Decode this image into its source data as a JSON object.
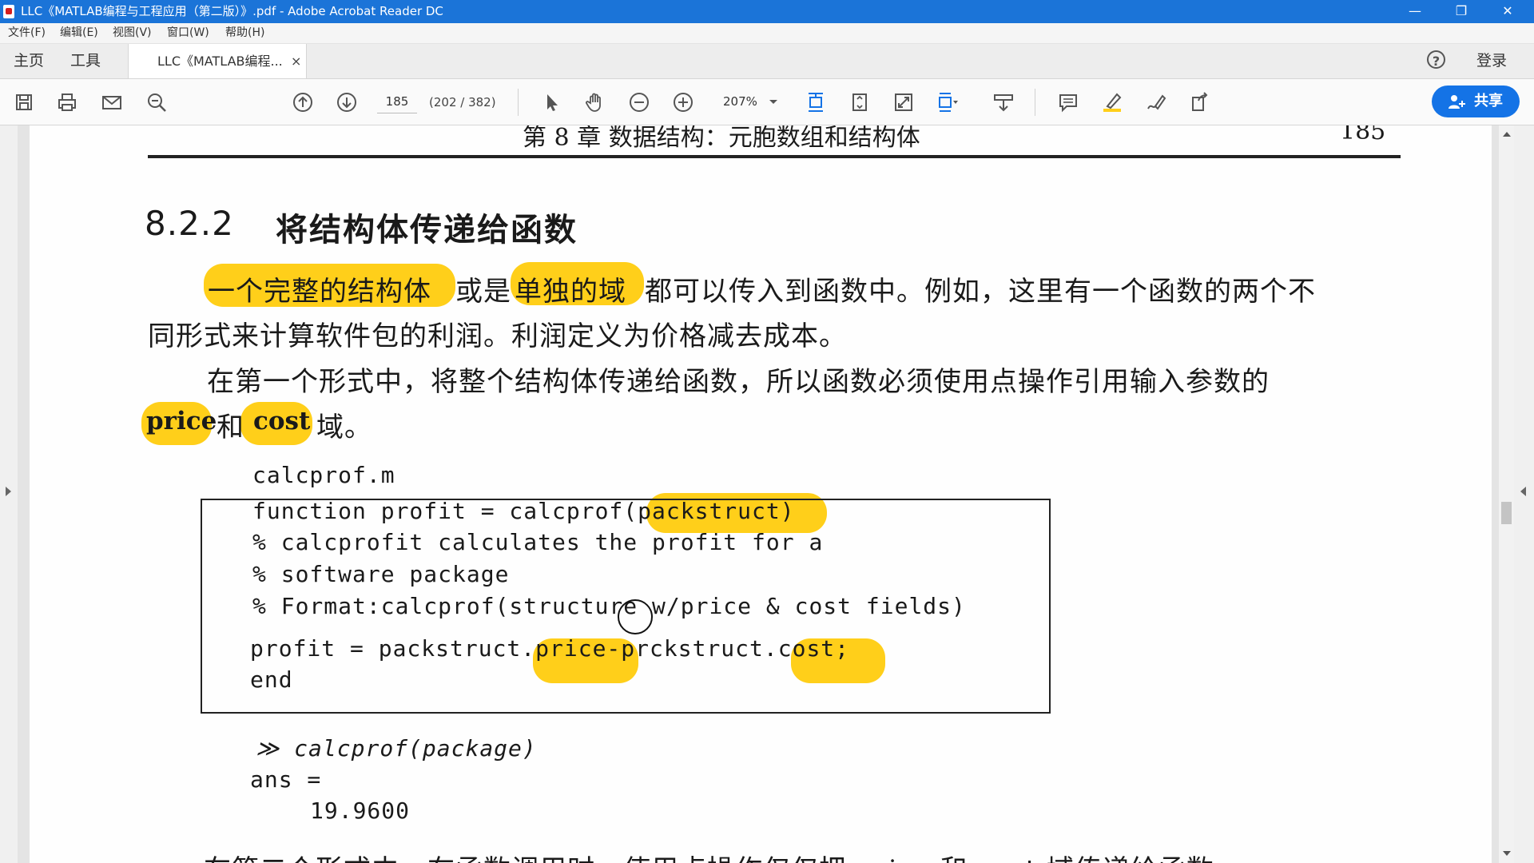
{
  "window": {
    "title": "LLC《MATLAB编程与工程应用（第二版）》.pdf - Adobe Acrobat Reader DC",
    "minimize": "—",
    "restore": "❐",
    "close": "✕"
  },
  "menu": [
    "文件(F)",
    "编辑(E)",
    "视图(V)",
    "窗口(W)",
    "帮助(H)"
  ],
  "tabs": {
    "home": "主页",
    "tools": "工具",
    "document": "LLC《MATLAB编程...",
    "close": "×"
  },
  "header_right": {
    "help": "?",
    "login": "登录"
  },
  "toolbar": {
    "page_number": "185",
    "page_count": "(202 / 382)",
    "zoom": "207%",
    "share_label": "共享"
  },
  "icons": [
    "save-icon",
    "print-icon",
    "email-icon",
    "search-zoom-icon",
    "page-up-icon",
    "page-down-icon",
    "select-arrow-icon",
    "hand-icon",
    "zoom-out-icon",
    "zoom-in-icon",
    "scroll-mode-icon",
    "fit-page-icon",
    "fullscreen-icon",
    "page-display-icon",
    "read-mode-icon",
    "comment-icon",
    "highlight-icon",
    "sign-icon",
    "share-icon"
  ],
  "colors": {
    "accent": "#1473e6",
    "titlebar": "#1b74d8",
    "highlight": "#ffcf1a"
  },
  "document": {
    "running_head": "第 8 章   数据结构：元胞数组和结构体",
    "running_page": "185",
    "heading_number": "8.2.2",
    "heading_text": "将结构体传递给函数",
    "p1_hl1": "一个完整的结构体",
    "p1_mid1": "或是",
    "p1_hl2": "单独的域",
    "p1_rest": "都可以传入到函数中。例如，这里有一个函数的两个不",
    "p1_line2": "同形式来计算软件包的利润。利润定义为价格减去成本。",
    "p2_line1": "在第一个形式中，将整个结构体传递给函数，所以函数必须使用点操作引用输入参数的",
    "p2_price": "price",
    "p2_and": "和",
    "p2_cost": "cost",
    "p2_end": "域。",
    "code_filename": "calcprof.m",
    "code_lines": [
      "function profit = calcprof(packstruct)",
      "% calcprofit calculates the profit for a",
      "% software package",
      "% Format:calcprof(structure w/price & cost fields)",
      "profit = packstruct.price-prckstruct.cost;",
      "end"
    ],
    "cmd_prompt": "≫ calcprof(package)",
    "cmd_ans": "ans =",
    "cmd_value": "19.9600",
    "bottom_partial": "在第二个形式中，在函数调用时，使用点操作仅仅把 price 和 cost 域传递给函数"
  }
}
